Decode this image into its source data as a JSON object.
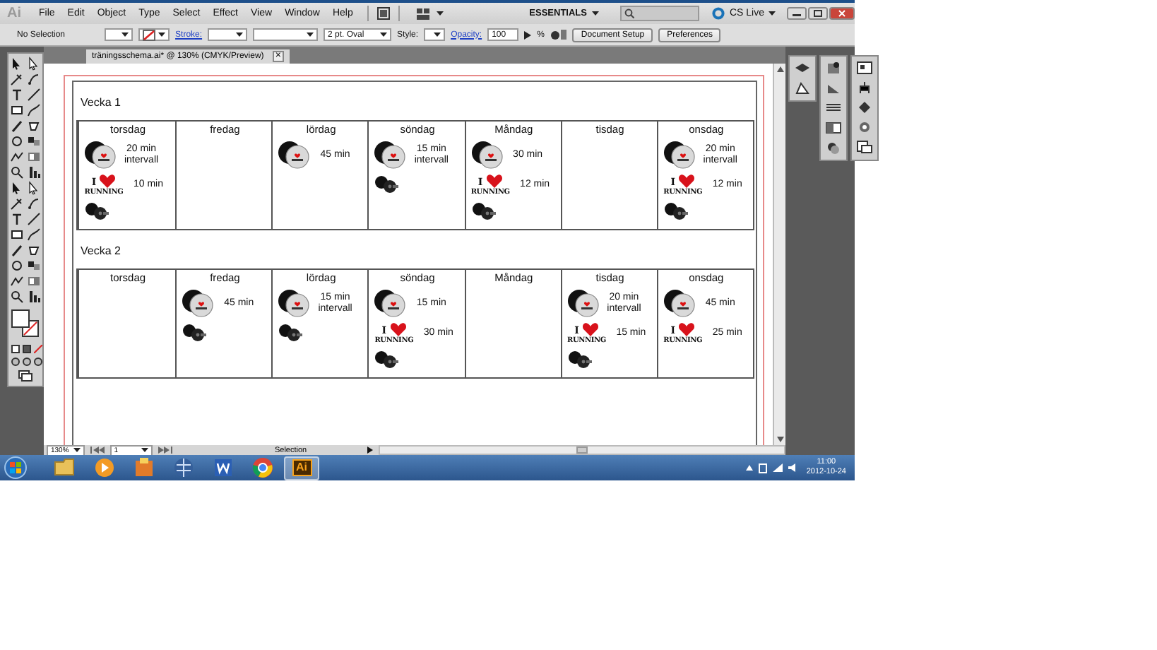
{
  "menu_bar": {
    "logo": "Ai",
    "menus": [
      "File",
      "Edit",
      "Object",
      "Type",
      "Select",
      "Effect",
      "View",
      "Window",
      "Help"
    ],
    "workspace": "ESSENTIALS",
    "cs_live": "CS Live"
  },
  "control_bar": {
    "selection": "No Selection",
    "stroke_label": "Stroke:",
    "brush": "2 pt. Oval",
    "style_label": "Style:",
    "opacity_label": "Opacity:",
    "opacity": "100",
    "percent": "%",
    "buttons": [
      "Document Setup",
      "Preferences"
    ]
  },
  "document_tab": {
    "title": "träningsschema.ai* @ 130% (CMYK/Preview)",
    "close": "×"
  },
  "weeks": [
    {
      "title": "Vecka 1",
      "days": [
        {
          "name": "torsdag",
          "activities": [
            {
              "kind": "spinning",
              "duration": "20 min intervall"
            },
            {
              "kind": "running",
              "logo_top": "I",
              "logo_bottom": "RUNNING",
              "duration": "10 min"
            },
            {
              "kind": "weights"
            }
          ]
        },
        {
          "name": "fredag"
        },
        {
          "name": "lördag",
          "activities": [
            {
              "kind": "spinning",
              "duration": "45 min"
            }
          ]
        },
        {
          "name": "söndag",
          "activities": [
            {
              "kind": "spinning",
              "duration": "15 min intervall"
            },
            {
              "kind": "weights"
            }
          ]
        },
        {
          "name": "Måndag",
          "activities": [
            {
              "kind": "spinning",
              "duration": "30 min"
            },
            {
              "kind": "running",
              "logo_top": "I",
              "logo_bottom": "RUNNING",
              "duration": "12 min"
            },
            {
              "kind": "weights"
            }
          ]
        },
        {
          "name": "tisdag"
        },
        {
          "name": "onsdag",
          "activities": [
            {
              "kind": "spinning",
              "duration": "20 min intervall"
            },
            {
              "kind": "running",
              "logo_top": "I",
              "logo_bottom": "RUNNING",
              "duration": "12 min"
            },
            {
              "kind": "weights"
            }
          ]
        }
      ]
    },
    {
      "title": "Vecka 2",
      "days": [
        {
          "name": "torsdag"
        },
        {
          "name": "fredag",
          "activities": [
            {
              "kind": "spinning",
              "duration": "45 min"
            },
            {
              "kind": "weights"
            }
          ]
        },
        {
          "name": "lördag",
          "activities": [
            {
              "kind": "spinning",
              "duration": "15 min intervall"
            },
            {
              "kind": "weights"
            }
          ]
        },
        {
          "name": "söndag",
          "activities": [
            {
              "kind": "spinning",
              "duration": "15 min"
            },
            {
              "kind": "running",
              "logo_top": "I",
              "logo_bottom": "RUNNING",
              "duration": "30 min"
            },
            {
              "kind": "weights"
            }
          ]
        },
        {
          "name": "Måndag"
        },
        {
          "name": "tisdag",
          "activities": [
            {
              "kind": "spinning",
              "duration": "20 min intervall"
            },
            {
              "kind": "running",
              "logo_top": "I",
              "logo_bottom": "RUNNING",
              "duration": "15 min"
            },
            {
              "kind": "weights"
            }
          ]
        },
        {
          "name": "onsdag",
          "activities": [
            {
              "kind": "spinning",
              "duration": "45 min"
            },
            {
              "kind": "running",
              "logo_top": "I",
              "logo_bottom": "RUNNING",
              "duration": "25 min"
            }
          ]
        }
      ]
    }
  ],
  "status_bar": {
    "zoom": "130%",
    "page": "1",
    "tool": "Selection"
  },
  "taskbar": {
    "apps": [
      {
        "kind": "folder",
        "selected": false
      },
      {
        "kind": "media",
        "selected": false
      },
      {
        "kind": "box",
        "selected": false
      },
      {
        "kind": "globe",
        "selected": false
      },
      {
        "kind": "document",
        "selected": false
      },
      {
        "kind": "browser",
        "selected": false
      },
      {
        "kind": "illustrator",
        "label": "Ai",
        "selected": true
      }
    ],
    "time": "11:00",
    "date": "2012-10-24"
  }
}
